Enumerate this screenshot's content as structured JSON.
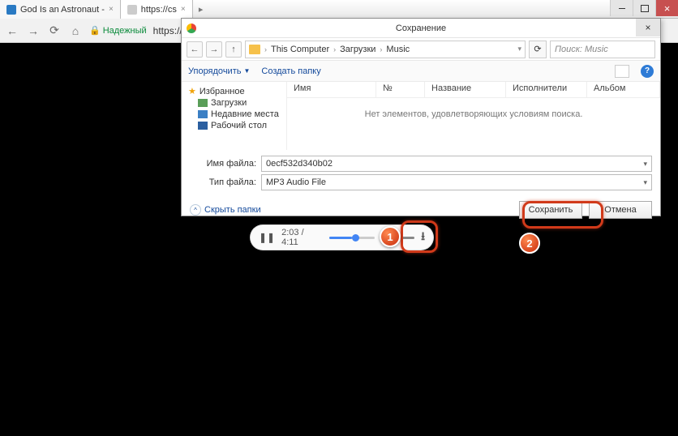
{
  "tabs": [
    {
      "title": "God Is an Astronaut - ",
      "active": false
    },
    {
      "title": "https://cs",
      "active": true
    }
  ],
  "addressbar": {
    "secure_label": "Надежный",
    "url": "https://c"
  },
  "player": {
    "time_current": "2:03",
    "time_total": "4:11",
    "separator": "/"
  },
  "dialog": {
    "title": "Сохранение",
    "nav": {
      "crumb_computer": "This Computer",
      "crumb_downloads": "Загрузки",
      "crumb_music": "Music",
      "search_placeholder": "Поиск: Music"
    },
    "toolbar": {
      "organize": "Упорядочить",
      "new_folder": "Создать папку"
    },
    "tree": {
      "favorites": "Избранное",
      "downloads": "Загрузки",
      "recent": "Недавние места",
      "desktop": "Рабочий стол"
    },
    "columns": {
      "name": "Имя",
      "number": "№",
      "title": "Название",
      "artists": "Исполнители",
      "album": "Альбом"
    },
    "empty_msg": "Нет элементов, удовлетворяющих условиям поиска.",
    "fields": {
      "filename_label": "Имя файла:",
      "filename_value": "0ecf532d340b02",
      "filetype_label": "Тип файла:",
      "filetype_value": "MP3 Audio File"
    },
    "bottom": {
      "hide_folders": "Скрыть папки",
      "save": "Сохранить",
      "cancel": "Отмена"
    }
  },
  "callouts": {
    "one": "1",
    "two": "2"
  }
}
